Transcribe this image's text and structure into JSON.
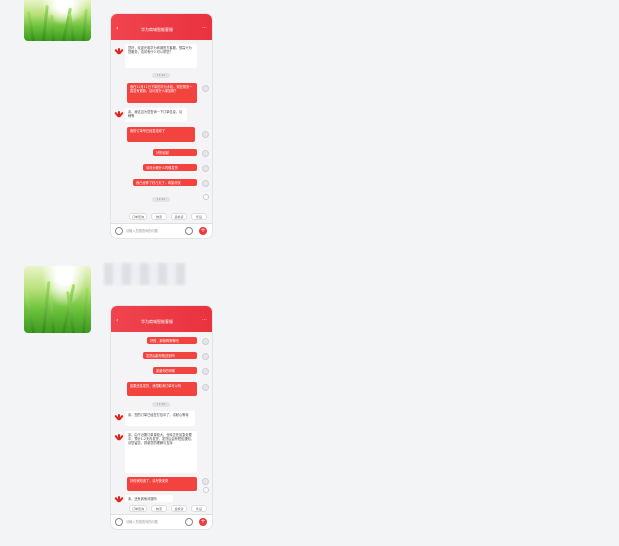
{
  "messages": [
    {
      "sender_name": "",
      "screenshot": {
        "header_title": "华为商城智能客服",
        "back_icon": "chevron-left-icon",
        "menu_icon": "more-icon",
        "timestamp": "11:24",
        "timestamp2": "11:25",
        "bot_bubbles": [
          "您好，欢迎光临华为商城官方客服，很高兴为您服务，请问有什么可以帮您？",
          "亲，我这边为您查询一下订单信息，请稍等"
        ],
        "user_bubbles": [
          "我在11月11日下单的华为手机，现在物流一直没有更新，请问是什么原因呢？",
          "我的订单号已经发给你了",
          "好的谢谢",
          "请问大概什么时候发货",
          "我已经等了好几天了，希望尽快"
        ],
        "quick_replies": [
          "订单查询",
          "物流",
          "退换货",
          "售后"
        ],
        "input_placeholder": "请输入您想咨询的问题"
      }
    },
    {
      "sender_name": "",
      "screenshot": {
        "header_title": "华为商城智能客服",
        "back_icon": "chevron-left-icon",
        "menu_icon": "more-icon",
        "timestamp": "11:30",
        "bot_bubbles": [
          "亲，您的订单已经在打包中了，请耐心等待",
          "亲，由于近期订单量较大，仓库正在加急处理中，预计1-2天内发货，发货后会有短信通知，请您留意，感谢您的理解与支持",
          "亲，还有其他问题吗"
        ],
        "user_bubbles": [
          "好的，那我再等等吧",
          "发货后能尽快送到吗",
          "谢谢你的帮助",
          "如果还没发货，我想取消订单可以吗",
          "好的我知道了，请尽快安排"
        ],
        "quick_replies": [
          "订单查询",
          "物流",
          "退换货",
          "售后"
        ],
        "input_placeholder": "请输入您想咨询的问题"
      }
    }
  ]
}
